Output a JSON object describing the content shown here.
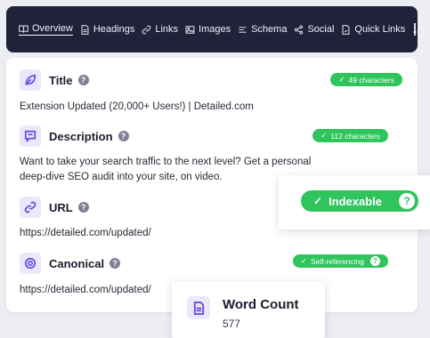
{
  "nav": {
    "items": [
      {
        "label": "Overview",
        "icon": "book-icon"
      },
      {
        "label": "Headings",
        "icon": "document-icon"
      },
      {
        "label": "Links",
        "icon": "link-icon"
      },
      {
        "label": "Images",
        "icon": "image-icon"
      },
      {
        "label": "Schema",
        "icon": "list-icon"
      },
      {
        "label": "Social",
        "icon": "share-icon"
      },
      {
        "label": "Quick Links",
        "icon": "quick-links-icon"
      }
    ],
    "settings_icon": "sliders-icon"
  },
  "sections": {
    "title": {
      "label": "Title",
      "badge": "49 characters",
      "value": "Extension Updated (20,000+ Users!) | Detailed.com"
    },
    "description": {
      "label": "Description",
      "badge": "112 characters",
      "value": "Want to take your search traffic to the next level? Get a personal deep-dive SEO audit into your site, on video."
    },
    "url": {
      "label": "URL",
      "value": "https://detailed.com/updated/"
    },
    "canonical": {
      "label": "Canonical",
      "badge": "Self-referencing",
      "value": "https://detailed.com/updated/"
    }
  },
  "indexable": {
    "label": "Indexable",
    "check": "✓",
    "help": "?"
  },
  "word_count": {
    "label": "Word Count",
    "value": "577"
  },
  "common": {
    "help": "?",
    "check": "✓"
  },
  "colors": {
    "accent": "#6d4cdf",
    "success": "#2fc45c",
    "nav_bg": "#20223a"
  }
}
